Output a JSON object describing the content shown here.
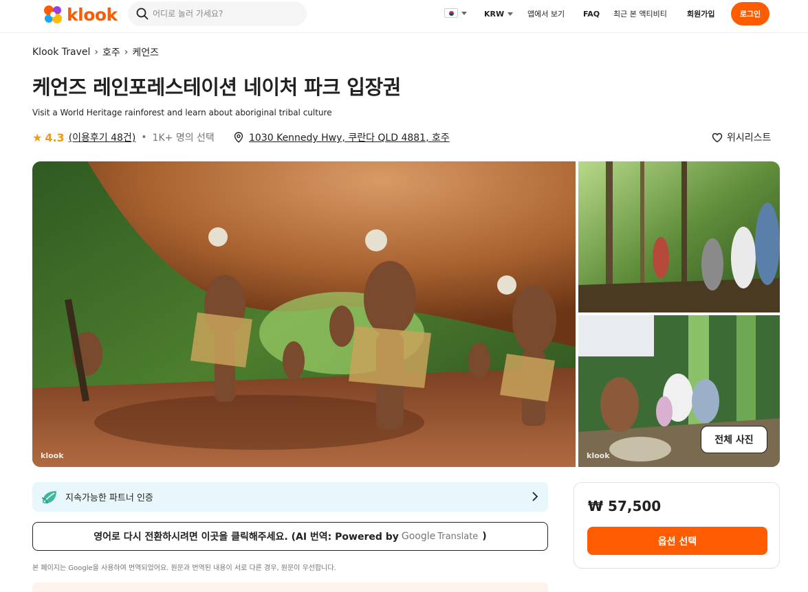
{
  "header": {
    "logo_text": "klook",
    "search_placeholder": "어디로 놀러 가세요?",
    "currency": "KRW",
    "nav": [
      "앱에서 보기",
      "FAQ",
      "최근 본 액티비티",
      "회원가입"
    ],
    "login_label": "로그인",
    "brand_color": "#ff5b00"
  },
  "breadcrumb": [
    "Klook Travel",
    "호주",
    "케언즈"
  ],
  "activity": {
    "title": "케언즈 레인포레스테이션 네이처 파크 입장권",
    "subtitle": "Visit a World Heritage rainforest and learn about aboriginal tribal culture",
    "rating": "4.3",
    "reviews": "(이용후기 48건)",
    "booked": "1K+ 명의 선택",
    "address": "1030 Kennedy Hwy, 쿠란다 QLD 4881, 호주",
    "wishlist_label": "위시리스트"
  },
  "gallery": {
    "watermark": "klook",
    "all_photos_label": "전체 사진"
  },
  "partner": {
    "label": "지속가능한 파트너 인증"
  },
  "translate": {
    "text": "영어로 다시 전환하시려면 이곳을 클릭해주세요. (AI 번역: Powered by",
    "google": "Google",
    "translate_word": "Translate",
    "close_paren": ")",
    "note": "본 페이지는 Google을 사용하여 번역되었어요. 원문과 번역된 내용이 서로 다른 경우, 원문이 우선합니다."
  },
  "booking": {
    "price": "₩ 57,500",
    "select_label": "옵션 선택"
  }
}
